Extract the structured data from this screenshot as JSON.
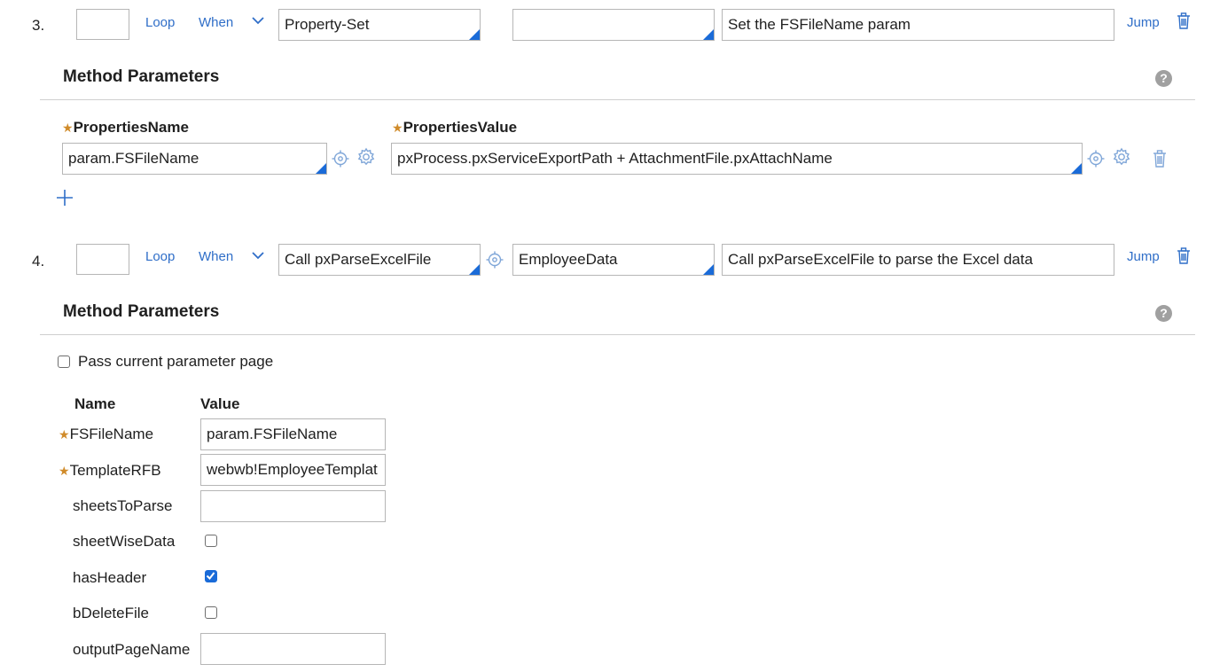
{
  "steps": [
    {
      "number": "3.",
      "loop_label": "Loop",
      "when_label": "When",
      "method_value": "Property-Set",
      "step_page_value": "",
      "description_value": "Set the FSFileName param",
      "jump_label": "Jump",
      "params_title": "Method Parameters",
      "help_glyph": "?",
      "columns": {
        "name": "PropertiesName",
        "value": "PropertiesValue"
      },
      "row": {
        "name": "param.FSFileName",
        "value": "pxProcess.pxServiceExportPath + AttachmentFile.pxAttachName"
      }
    },
    {
      "number": "4.",
      "loop_label": "Loop",
      "when_label": "When",
      "method_value": "Call pxParseExcelFile",
      "step_page_value": "EmployeeData",
      "description_value": "Call pxParseExcelFile to parse the Excel data",
      "jump_label": "Jump",
      "params_title": "Method Parameters",
      "help_glyph": "?",
      "pass_param_page_label": "Pass current parameter page",
      "pass_param_page_checked": false,
      "table_headers": {
        "name": "Name",
        "value": "Value"
      },
      "params": [
        {
          "name": "FSFileName",
          "required": true,
          "type": "text",
          "value": "param.FSFileName"
        },
        {
          "name": "TemplateRFB",
          "required": true,
          "type": "text",
          "value": "webwb!EmployeeTemplat"
        },
        {
          "name": "sheetsToParse",
          "required": false,
          "type": "text",
          "value": ""
        },
        {
          "name": "sheetWiseData",
          "required": false,
          "type": "checkbox",
          "checked": false
        },
        {
          "name": "hasHeader",
          "required": false,
          "type": "checkbox",
          "checked": true
        },
        {
          "name": "bDeleteFile",
          "required": false,
          "type": "checkbox",
          "checked": false
        },
        {
          "name": "outputPageName",
          "required": false,
          "type": "text",
          "value": ""
        }
      ]
    }
  ],
  "icons": {
    "chevron": "chevron-down-icon",
    "crosshair": "crosshair-icon",
    "gear": "gear-icon",
    "trash": "trash-icon",
    "add": "plus-icon"
  },
  "colors": {
    "accent": "#1a6bd8",
    "link": "#2f6ec8",
    "required": "#d08b2a"
  }
}
